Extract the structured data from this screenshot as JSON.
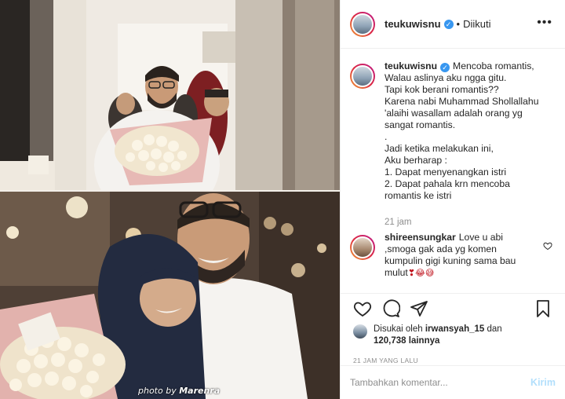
{
  "header": {
    "username": "teukuwisnu",
    "separator": "•",
    "follow_status": "Diikuti",
    "more_icon": "more-horizontal-icon"
  },
  "photo": {
    "credit_prefix": "photo by ",
    "credit_name": "Marenra"
  },
  "caption": {
    "username": "teukuwisnu",
    "lines": [
      "Mencoba romantis,",
      "Walau aslinya aku ngga gitu.",
      "Tapi kok berani romantis??",
      "Karena nabi Muhammad Shollallahu",
      "'alaihi wasallam adalah orang yg",
      "sangat romantis.",
      ".",
      "Jadi ketika melakukan ini,",
      "Aku berharap :",
      "1. Dapat menyenangkan istri",
      "2. Dapat pahala krn mencoba",
      "romantis ke istri"
    ],
    "time": "21 jam"
  },
  "comment": {
    "username": "shireensungkar",
    "lines": [
      "Love u abi",
      ",smoga gak ada yg komen",
      "kumpulin gigi kuning sama bau",
      "mulut"
    ],
    "emojis": "❣😂😅"
  },
  "likes": {
    "prefix": "Disukai oleh ",
    "user": "irwansyah_15",
    "and": " dan",
    "count": "120,738",
    "suffix": " lainnya"
  },
  "posted_time": "21 JAM YANG LALU",
  "comment_input": {
    "placeholder": "Tambahkan komentar...",
    "post_label": "Kirim"
  },
  "colors": {
    "verified": "#3897f0",
    "post_button_disabled": "#b2dffc",
    "secondary_text": "#8e8e8e"
  }
}
